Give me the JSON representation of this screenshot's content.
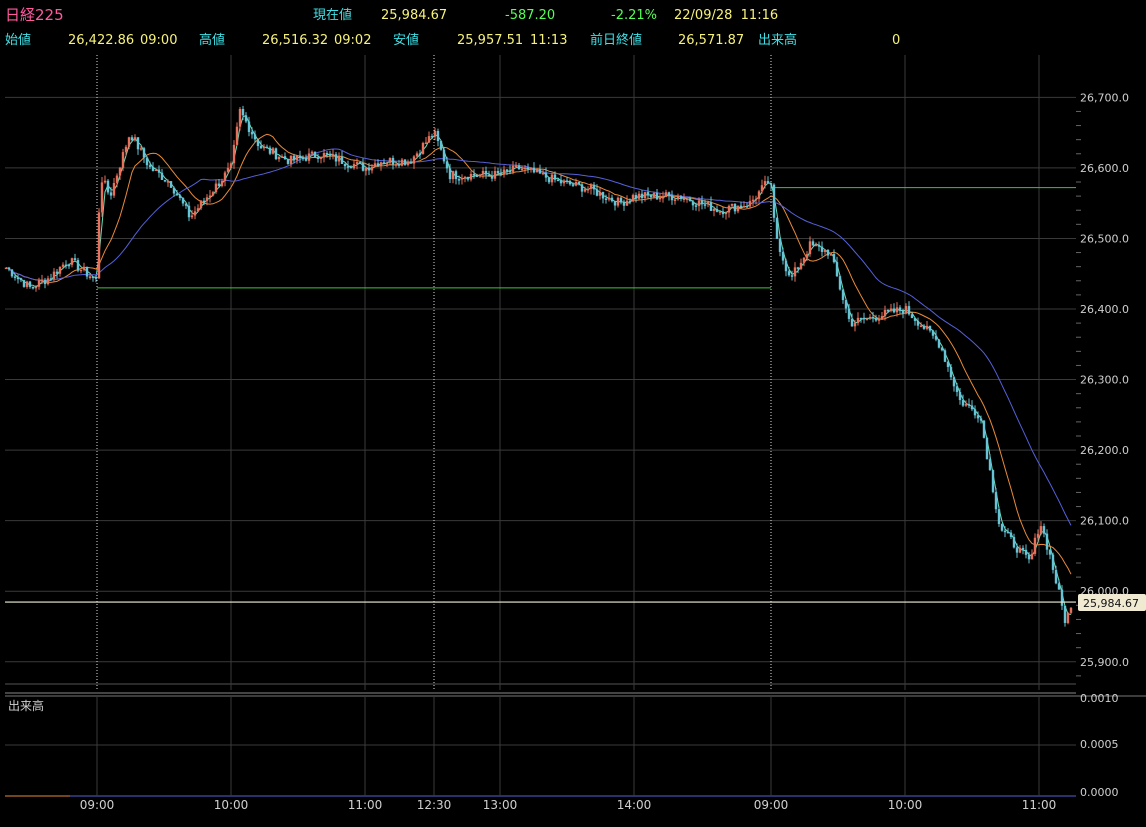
{
  "header": {
    "symbol": "日経225",
    "current_label": "現在値",
    "current_value": "25,984.67",
    "change": "-587.20",
    "change_pct": "-2.21%",
    "datetime": "22/09/28  11:16",
    "open_label": "始値",
    "open_value": "26,422.86",
    "open_time": "09:00",
    "high_label": "高値",
    "high_value": "26,516.32",
    "high_time": "09:02",
    "low_label": "安値",
    "low_value": "25,957.51",
    "low_time": "11:13",
    "prev_close_label": "前日終値",
    "prev_close_value": "26,571.87",
    "volume_label": "出来高",
    "volume_value": "0"
  },
  "volume_panel": {
    "label": "出来高"
  },
  "price_tag": "25,984.67",
  "colors": {
    "up": "#e8705a",
    "down": "#66c4d6",
    "ma_short": "#66e0c0",
    "ma_mid": "#e88a3a",
    "ma_long": "#5560d8",
    "ref_line": "#3ec43e",
    "current_line": "#f4f0d8",
    "grid": "#3a3a3a",
    "session": "#dddddd"
  },
  "chart_data": {
    "type": "line",
    "title": "",
    "ylim": [
      25860,
      26760
    ],
    "y_ticks": [
      "26,700.0",
      "26,600.0",
      "26,500.0",
      "26,400.0",
      "26,300.0",
      "26,200.0",
      "26,100.0",
      "26,000.0",
      "25,900.0"
    ],
    "x_ticks": [
      "09:00",
      "10:00",
      "11:00",
      "12:30",
      "13:00",
      "14:00",
      "09:00",
      "10:00",
      "11:00"
    ],
    "volume_ticks": [
      "0.0010",
      "0.0005",
      "0.0000"
    ],
    "series": [
      {
        "x": [
          "prev-14:30",
          "prev-14:40",
          "prev-14:50",
          "prev-15:00",
          "09:00",
          "09:05",
          "09:10",
          "09:20",
          "09:30",
          "09:40",
          "09:50",
          "10:00",
          "10:05",
          "10:15",
          "10:30",
          "10:45",
          "11:00",
          "11:15",
          "11:30",
          "12:30",
          "12:40",
          "13:00",
          "13:10",
          "13:20",
          "13:30",
          "13:45",
          "14:00",
          "14:15",
          "14:30",
          "14:45",
          "15:00",
          "09:00",
          "09:02",
          "09:05",
          "09:15",
          "09:30",
          "09:45",
          "10:00",
          "10:10",
          "10:20",
          "10:30",
          "10:40",
          "10:50",
          "11:00",
          "11:05",
          "11:10",
          "11:13",
          "11:16"
        ],
        "y": [
          26460,
          26430,
          26445,
          26470,
          26440,
          26590,
          26560,
          26650,
          26600,
          26580,
          26530,
          26600,
          26680,
          26630,
          26610,
          26620,
          26600,
          26610,
          26610,
          26650,
          26590,
          26590,
          26600,
          26580,
          26570,
          26550,
          26560,
          26560,
          26540,
          26550,
          26580,
          26570,
          26510,
          26440,
          26490,
          26480,
          26380,
          26400,
          26380,
          26350,
          26270,
          26250,
          26090,
          26040,
          26100,
          26050,
          25960,
          25985
        ]
      }
    ],
    "prev_close_ref": 26430,
    "day_ref": 26572,
    "current": 25984.67
  }
}
